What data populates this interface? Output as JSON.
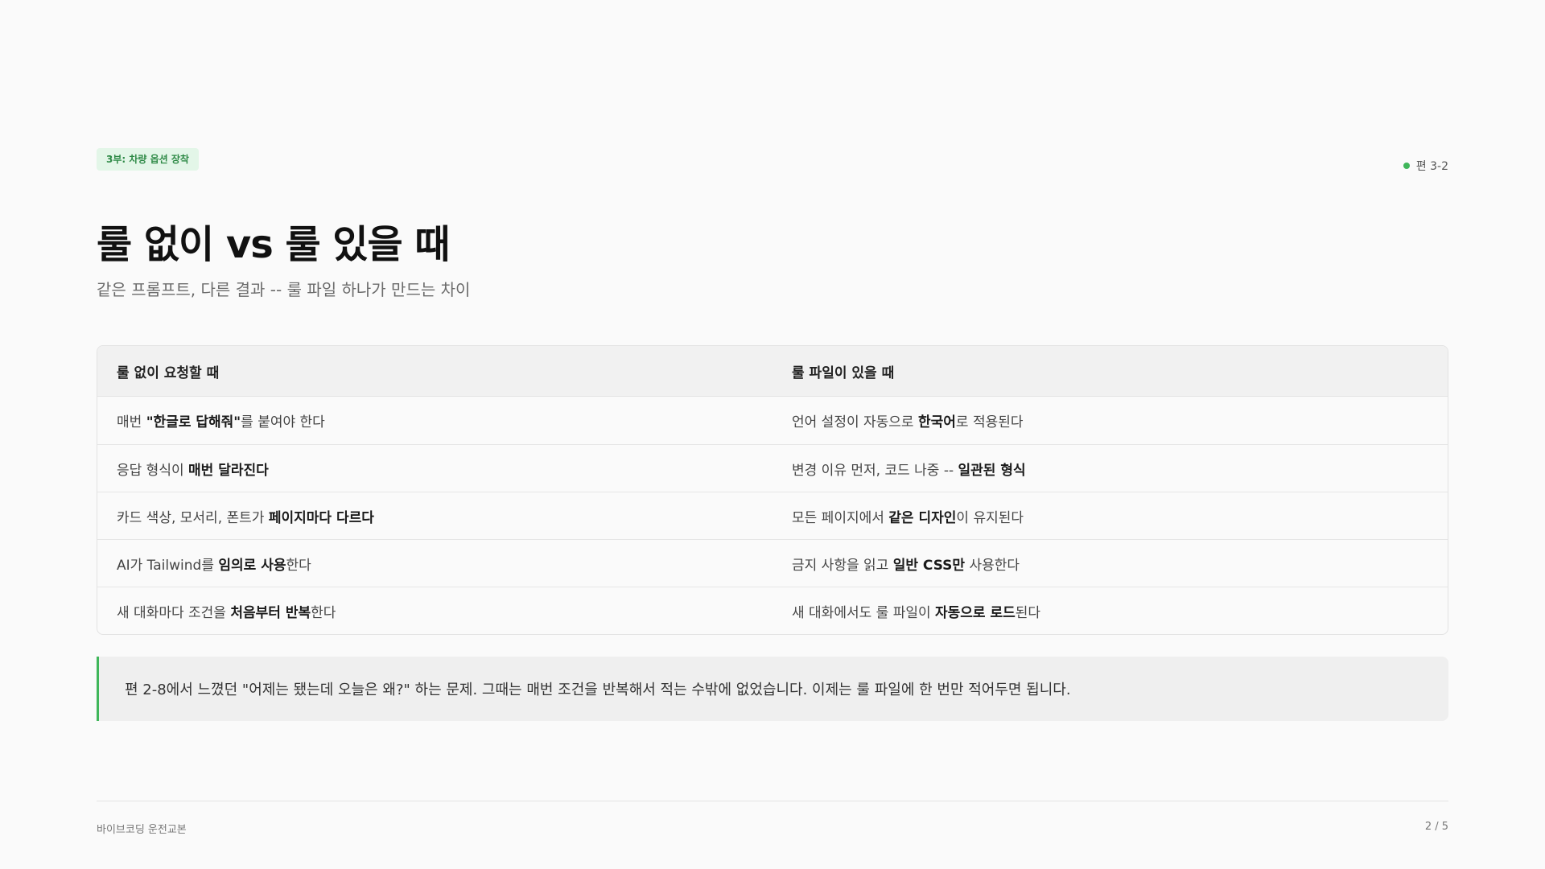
{
  "header": {
    "badge": "3부: 차량 옵션 장착",
    "episode": "편 3-2",
    "accent_color": "#3fb65a"
  },
  "title": "룰 없이 vs 룰 있을 때",
  "subtitle": "같은 프롬프트, 다른 결과 -- 룰 파일 하나가 만드는 차이",
  "table": {
    "headers": [
      "룰 없이 요청할 때",
      "룰 파일이 있을 때"
    ],
    "rows": [
      {
        "left": {
          "before": "매번 ",
          "bold": "\"한글로 답해줘\"",
          "after": "를 붙여야 한다"
        },
        "right": {
          "before": "언어 설정이 자동으로 ",
          "bold": "한국어",
          "after": "로 적용된다"
        }
      },
      {
        "left": {
          "before": "응답 형식이 ",
          "bold": "매번 달라진다",
          "after": ""
        },
        "right": {
          "before": "변경 이유 먼저, 코드 나중 -- ",
          "bold": "일관된 형식",
          "after": ""
        }
      },
      {
        "left": {
          "before": "카드 색상, 모서리, 폰트가 ",
          "bold": "페이지마다 다르다",
          "after": ""
        },
        "right": {
          "before": "모든 페이지에서 ",
          "bold": "같은 디자인",
          "after": "이 유지된다"
        }
      },
      {
        "left": {
          "before": "AI가 Tailwind를 ",
          "bold": "임의로 사용",
          "after": "한다"
        },
        "right": {
          "before": "금지 사항을 읽고 ",
          "bold": "일반 CSS만",
          "after": " 사용한다"
        }
      },
      {
        "left": {
          "before": "새 대화마다 조건을 ",
          "bold": "처음부터 반복",
          "after": "한다"
        },
        "right": {
          "before": "새 대화에서도 룰 파일이 ",
          "bold": "자동으로 로드",
          "after": "된다"
        }
      }
    ]
  },
  "callout": "편 2-8에서 느꼈던 \"어제는 됐는데 오늘은 왜?\" 하는 문제. 그때는 매번 조건을 반복해서 적는 수밖에 없었습니다. 이제는 룰 파일에 한 번만 적어두면 됩니다.",
  "footer": {
    "left": "바이브코딩 운전교본",
    "right": "2 / 5"
  }
}
